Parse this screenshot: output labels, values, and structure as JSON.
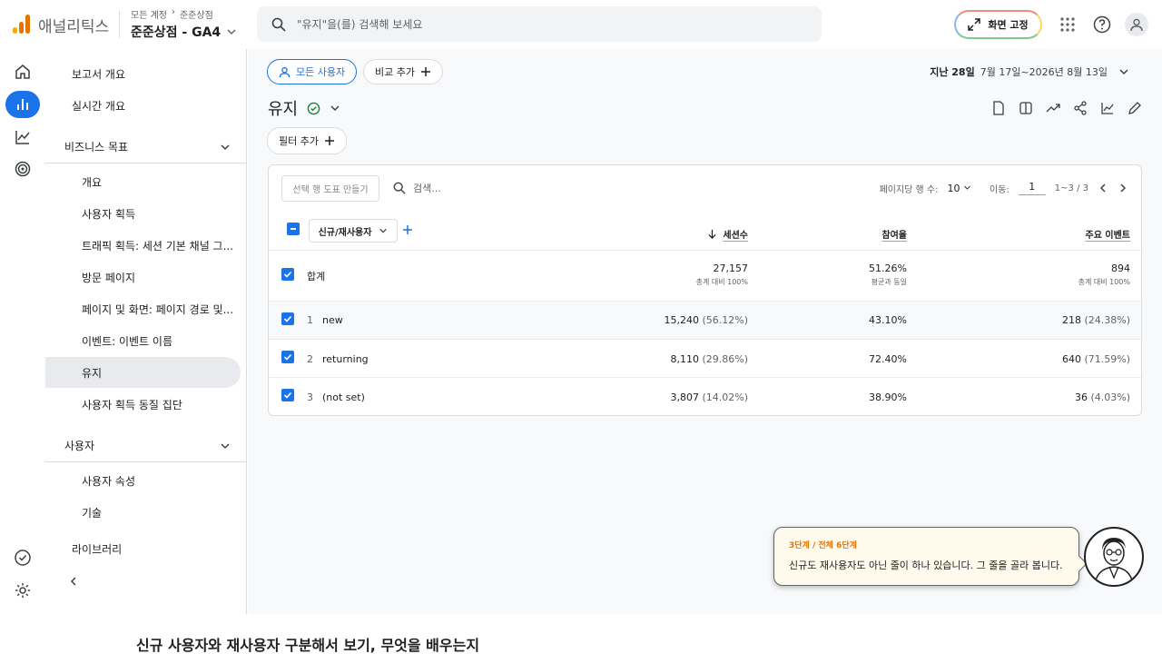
{
  "app": {
    "name": "애널리틱스"
  },
  "breadcrumb": {
    "first": "모든 계정",
    "second": "준준상점"
  },
  "property": {
    "name": "준준상점 - GA4"
  },
  "search": {
    "placeholder": "\"유지\"을(를) 검색해 보세요"
  },
  "header": {
    "pin_label": "화면 고정"
  },
  "rail": {
    "icons": [
      "home-icon",
      "reports-icon",
      "explore-icon",
      "advertising-icon",
      "admin-check-icon",
      "settings-icon"
    ]
  },
  "nav": {
    "overview": "보고서 개요",
    "realtime": "실시간 개요",
    "business_section": "비즈니스 목표",
    "business_items": [
      "개요",
      "사용자 획득",
      "트래픽 획득: 세션 기본 채널 그...",
      "방문 페이지",
      "페이지 및 화면: 페이지 경로 및...",
      "이벤트: 이벤트 이름",
      "유지",
      "사용자 획득 동질 집단"
    ],
    "user_section": "사용자",
    "user_items": [
      "사용자 속성",
      "기술"
    ],
    "library": "라이브러리"
  },
  "toolbar": {
    "all_users": "모든 사용자",
    "add_compare": "비교 추가",
    "add_filter": "필터 추가"
  },
  "date": {
    "label": "지난 28일",
    "range": "7월 17일~2026년 8월 13일"
  },
  "report": {
    "title": "유지"
  },
  "table": {
    "create_chart": "선택 행 도표 만들기",
    "search_placeholder": "검색...",
    "rows_per_page_label": "페이지당 행 수:",
    "rows_per_page": "10",
    "goto_label": "이동:",
    "goto_value": "1",
    "range": "1~3 / 3",
    "dimension": "신규/재사용자",
    "columns": [
      "세션수",
      "참여율",
      "주요 이벤트"
    ],
    "total": {
      "label": "합계",
      "sessions": "27,157",
      "sessions_sub": "총계 대비 100%",
      "engagement": "51.26%",
      "engagement_sub": "평균과 동일",
      "events": "894",
      "events_sub": "총계 대비 100%"
    },
    "rows": [
      {
        "n": "1",
        "label": "new",
        "sessions": "15,240",
        "sessions_pct": "(56.12%)",
        "engagement": "43.10%",
        "events": "218",
        "events_pct": "(24.38%)"
      },
      {
        "n": "2",
        "label": "returning",
        "sessions": "8,110",
        "sessions_pct": "(29.86%)",
        "engagement": "72.40%",
        "events": "640",
        "events_pct": "(71.59%)"
      },
      {
        "n": "3",
        "label": "(not set)",
        "sessions": "3,807",
        "sessions_pct": "(14.02%)",
        "engagement": "38.90%",
        "events": "36",
        "events_pct": "(4.03%)"
      }
    ]
  },
  "tip": {
    "step": "3단계 / 전체 6단계",
    "message": "신규도 재사용자도 아닌 줄이 하나 있습니다. 그 줄을 골라 봅니다."
  },
  "footer": {
    "heading": "신규 사용자와 재사용자 구분해서 보기, 무엇을 배우는지"
  },
  "colors": {
    "accent": "#1a73e8",
    "brand_orange": "#e37400"
  }
}
